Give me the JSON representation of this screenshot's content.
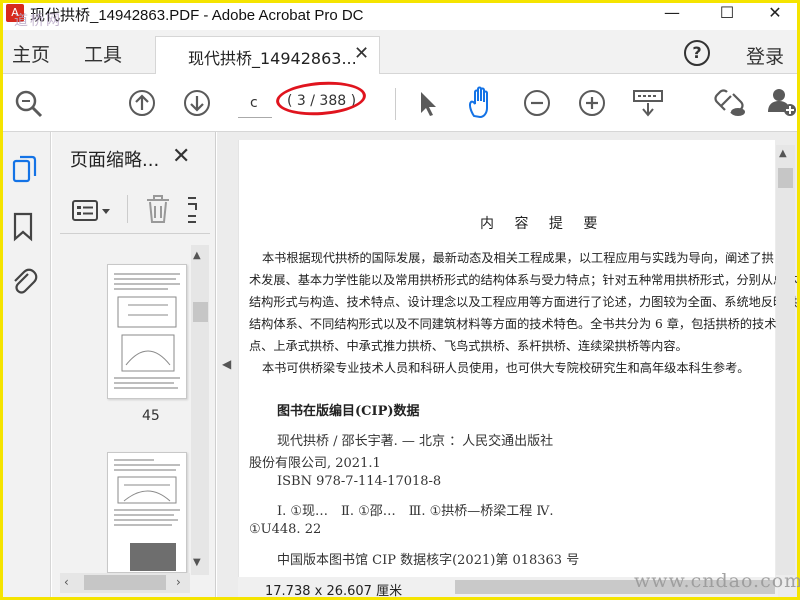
{
  "window": {
    "title": "现代拱桥_14942863.PDF - Adobe Acrobat Pro DC",
    "app_icon": "acrobat-icon",
    "watermark_top": "道桥网",
    "minimize": "—",
    "maximize": "☐",
    "close": "✕"
  },
  "menu": {
    "home": "主页",
    "tools": "工具"
  },
  "tab": {
    "label": "现代拱桥_14942863...",
    "close": "✕"
  },
  "header_right": {
    "help": "?",
    "login": "登录"
  },
  "toolbar": {
    "page_input": "c",
    "page_count": "( 3 / 388 )",
    "highlight_color": "#e0141e"
  },
  "panel": {
    "title": "页面缩略...",
    "close": "✕",
    "thumb_label": "45"
  },
  "document": {
    "heading": "内 容 提 要",
    "paragraphs": [
      "本书根据现代拱桥的国际发展，最新动态及相关工程成果，以工程应用与实践为导向，阐述了拱",
      "术发展、基本力学性能以及常用拱桥形式的结构体系与受力特点；针对五种常用拱桥形式，分别从总体",
      "结构形式与构造、技术特点、设计理念以及工程应用等方面进行了论述，力图较为全面、系统地反映拱",
      "结构体系、不同结构形式以及不同建筑材料等方面的技术特色。全书共分为 6 章，包括拱桥的技术发",
      "点、上承式拱桥、中承式推力拱桥、飞鸟式拱桥、系杆拱桥、连续梁拱桥等内容。",
      "本书可供桥梁专业技术人员和科研人员使用，也可供大专院校研究生和高年级本科生参考。"
    ],
    "cip_title": "图书在版编目(CIP)数据",
    "cip_lines": [
      "现代拱桥 / 邵长宇著. — 北京 ：人民交通出版社",
      "股份有限公司, 2021.1",
      "ISBN  978-7-114-17018-8",
      "Ⅰ. ①现…　Ⅱ. ①邵…　Ⅲ. ①拱桥—桥梁工程  Ⅳ.",
      "①U448. 22",
      "中国版本图书馆 CIP 数据核字(2021)第 018363 号"
    ]
  },
  "status": {
    "page_size": "17.738 x 26.607 厘米",
    "watermark": "www.cndao.com"
  },
  "colors": {
    "frame": "#f5e400",
    "acrobat_red": "#d7291d",
    "hand_tool_blue": "#1473e6",
    "side_icon_blue": "#1473e6"
  }
}
